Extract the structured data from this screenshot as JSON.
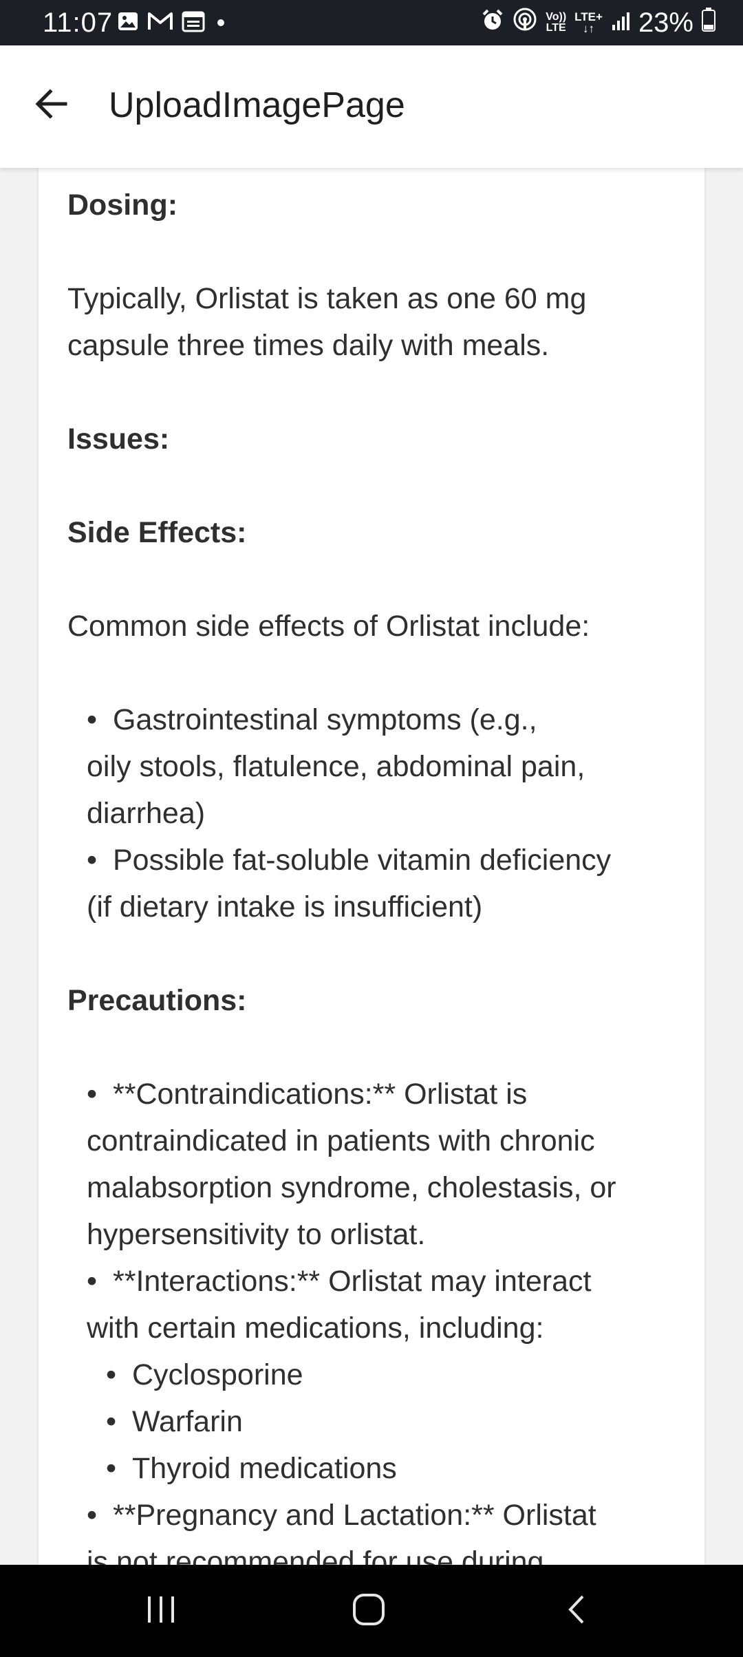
{
  "status_bar": {
    "time": "11:07",
    "battery": "23%",
    "icons_left": [
      "gallery-icon",
      "gmail-icon",
      "calendar-icon",
      "dot-icon"
    ],
    "icons_right": [
      "alarm-icon",
      "hotspot-icon",
      "volte-icon",
      "lte-icon",
      "signal-icon",
      "battery-icon"
    ],
    "volte_label_top": "Vo))",
    "volte_label_bottom": "LTE",
    "lte_label": "LTE+"
  },
  "app_bar": {
    "title": "UploadImagePage",
    "back_icon": "arrow-left-icon"
  },
  "content": {
    "dosing_heading": "Dosing:",
    "dosing_text_1": "Typically, Orlistat is taken as one 60 mg",
    "dosing_text_2": "capsule three times daily with meals.",
    "issues_heading": "Issues:",
    "side_effects_heading": "Side Effects:",
    "side_effects_intro": "Common side effects of Orlistat include:",
    "side_effects_bullets": [
      {
        "line1": "Gastrointestinal symptoms (e.g.,",
        "line2": "oily stools, flatulence, abdominal pain,",
        "line3": "diarrhea)"
      },
      {
        "line1": "Possible fat-soluble vitamin deficiency",
        "line2": "(if dietary intake is insufficient)"
      }
    ],
    "precautions_heading": "Precautions:",
    "precautions_bullets": [
      {
        "line1": "**Contraindications:** Orlistat is",
        "line2": "contraindicated in patients with chronic",
        "line3": "malabsorption syndrome, cholestasis, or",
        "line4": "hypersensitivity to orlistat."
      },
      {
        "line1": "**Interactions:** Orlistat may interact",
        "line2": "with certain medications, including:"
      }
    ],
    "interaction_sub_bullets": [
      "Cyclosporine",
      "Warfarin",
      "Thyroid medications"
    ],
    "pregnancy_bullet": {
      "line1": "**Pregnancy and Lactation:** Orlistat",
      "line2": "is not recommended for use during"
    },
    "bullet_char": "•"
  },
  "nav_bar": {
    "buttons": [
      "recent-apps-icon",
      "home-icon",
      "back-icon"
    ]
  },
  "colors": {
    "status_bar_bg": "#1c1f26",
    "page_bg": "#f2f2f2",
    "card_bg": "#ffffff",
    "text": "#2f2f2f",
    "nav_bar_bg": "#000000"
  }
}
